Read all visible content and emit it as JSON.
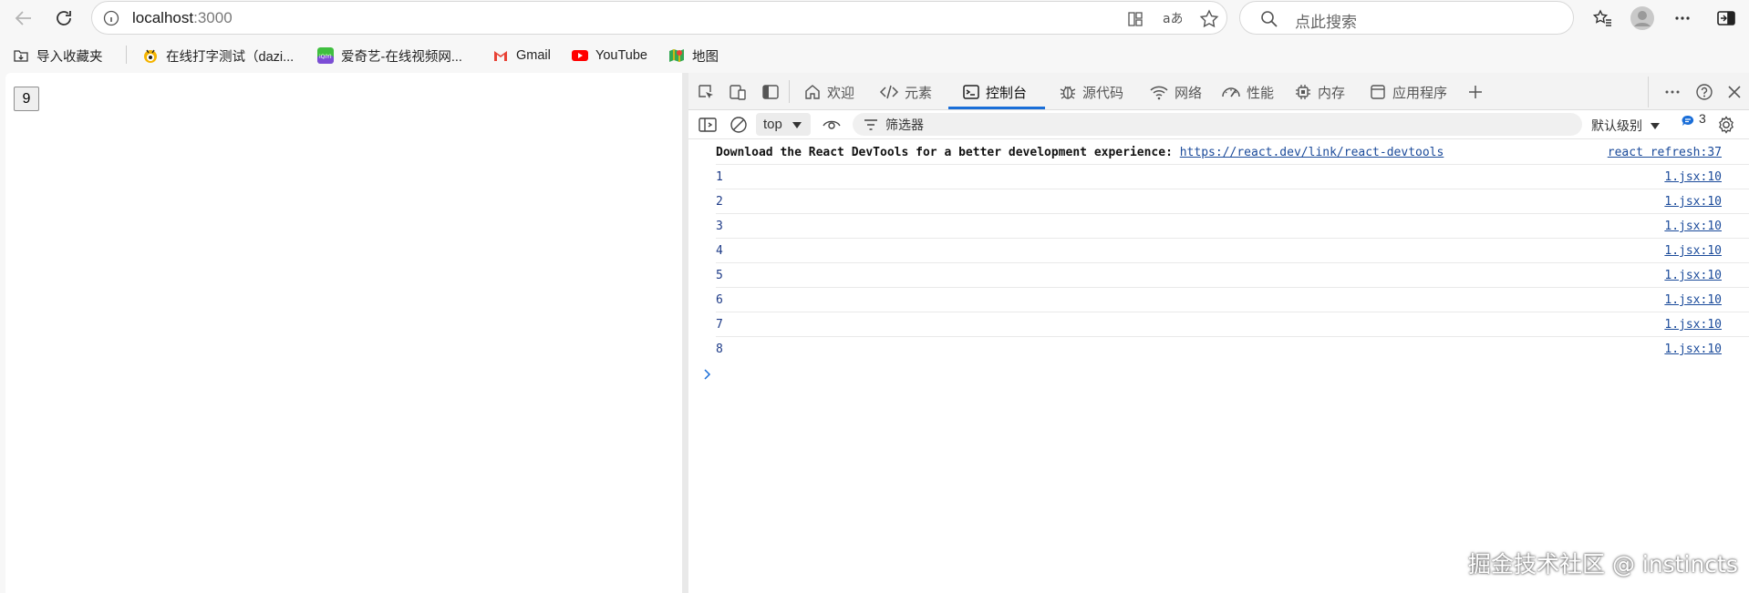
{
  "browser": {
    "address": {
      "host": "localhost",
      "port": ":3000"
    },
    "search_placeholder": "点此搜索"
  },
  "bookmarks": [
    {
      "label": "导入收藏夹",
      "icon": "import-favorites-icon"
    },
    {
      "label": "在线打字测试（dazi...",
      "icon": "typing-site-icon"
    },
    {
      "label": "爱奇艺-在线视频网...",
      "icon": "iqiyi-icon"
    },
    {
      "label": "Gmail",
      "icon": "gmail-icon"
    },
    {
      "label": "YouTube",
      "icon": "youtube-icon"
    },
    {
      "label": "地图",
      "icon": "maps-icon"
    }
  ],
  "page": {
    "counter_value": "9"
  },
  "devtools": {
    "tabs": [
      {
        "label": "欢迎",
        "icon": "home-icon"
      },
      {
        "label": "元素",
        "icon": "code-icon"
      },
      {
        "label": "控制台",
        "icon": "console-icon",
        "active": true
      },
      {
        "label": "源代码",
        "icon": "bug-icon"
      },
      {
        "label": "网络",
        "icon": "wifi-icon"
      },
      {
        "label": "性能",
        "icon": "gauge-icon"
      },
      {
        "label": "内存",
        "icon": "chip-icon"
      },
      {
        "label": "应用程序",
        "icon": "app-icon"
      }
    ],
    "context": "top",
    "filter_placeholder": "筛选器",
    "level": "默认级别",
    "issues_count": "3",
    "accent_color": "#1a6ed8"
  },
  "console": {
    "intro": {
      "text": "Download the React DevTools for a better development experience: ",
      "link": "https://react.dev/link/react-devtools",
      "source": "react refresh:37"
    },
    "logs": [
      {
        "msg": "1",
        "source": "1.jsx:10"
      },
      {
        "msg": "2",
        "source": "1.jsx:10"
      },
      {
        "msg": "3",
        "source": "1.jsx:10"
      },
      {
        "msg": "4",
        "source": "1.jsx:10"
      },
      {
        "msg": "5",
        "source": "1.jsx:10"
      },
      {
        "msg": "6",
        "source": "1.jsx:10"
      },
      {
        "msg": "7",
        "source": "1.jsx:10"
      },
      {
        "msg": "8",
        "source": "1.jsx:10"
      }
    ]
  },
  "watermark": "掘金技术社区 @ instincts"
}
